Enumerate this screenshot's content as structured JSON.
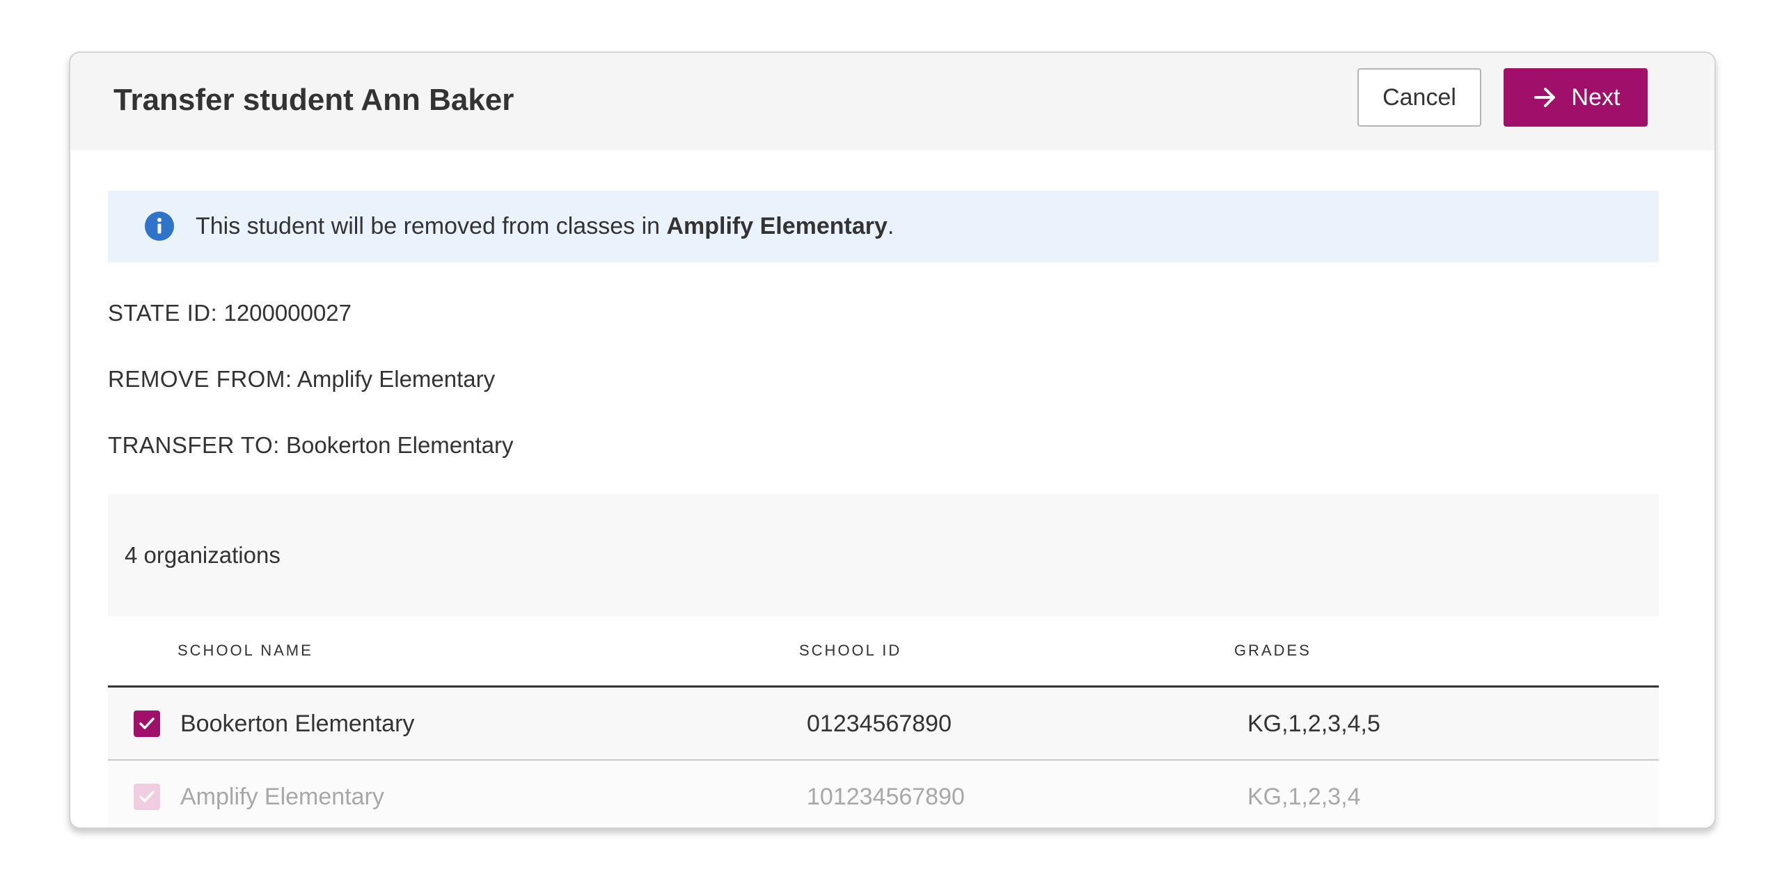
{
  "modal": {
    "title": "Transfer student Ann Baker",
    "cancel_label": "Cancel",
    "next_label": "Next"
  },
  "banner": {
    "icon": "info-icon",
    "text_prefix": "This student will be removed from classes in ",
    "school": "Amplify Elementary",
    "text_suffix": "."
  },
  "details": {
    "state_id_label": "STATE ID:",
    "state_id_value": "1200000027",
    "remove_from_label": "REMOVE FROM:",
    "remove_from_value": "Amplify Elementary",
    "transfer_to_label": "TRANSFER TO:",
    "transfer_to_value": "Bookerton Elementary"
  },
  "organizations": {
    "count_text": "4 organizations",
    "columns": [
      "SCHOOL NAME",
      "SCHOOL ID",
      "GRADES"
    ],
    "rows": [
      {
        "name": "Bookerton Elementary",
        "id": "01234567890",
        "grades": "KG,1,2,3,4,5",
        "checked": true,
        "disabled": false
      },
      {
        "name": "Amplify Elementary",
        "id": "101234567890",
        "grades": "KG,1,2,3,4",
        "checked": true,
        "disabled": true
      }
    ]
  },
  "colors": {
    "brand": "#a0106a",
    "banner_bg": "#eaf2fb",
    "info_icon": "#2f74c8",
    "header_bg": "#f5f5f5"
  }
}
